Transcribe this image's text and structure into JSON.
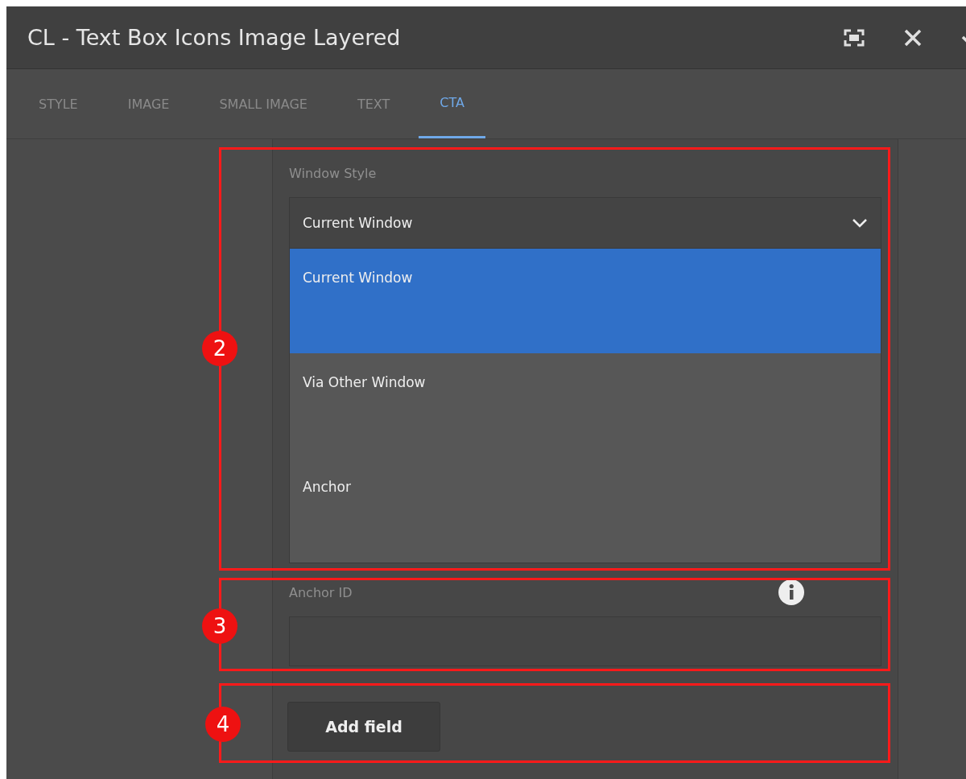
{
  "window": {
    "title": "CL - Text Box Icons Image Layered"
  },
  "tabs": [
    {
      "label": "STYLE",
      "selected": false
    },
    {
      "label": "IMAGE",
      "selected": false
    },
    {
      "label": "SMALL IMAGE",
      "selected": false
    },
    {
      "label": "TEXT",
      "selected": false
    },
    {
      "label": "CTA",
      "selected": true
    }
  ],
  "window_style": {
    "label": "Window Style",
    "value": "Current Window",
    "expanded": true,
    "options": [
      {
        "label": "Current Window",
        "selected": true
      },
      {
        "label": "Via Other Window",
        "selected": false
      },
      {
        "label": "Anchor",
        "selected": false
      }
    ]
  },
  "anchor_id": {
    "label": "Anchor ID"
  },
  "add_field_button": "Add field",
  "annotations": [
    {
      "number": "2"
    },
    {
      "number": "3"
    },
    {
      "number": "4"
    }
  ]
}
